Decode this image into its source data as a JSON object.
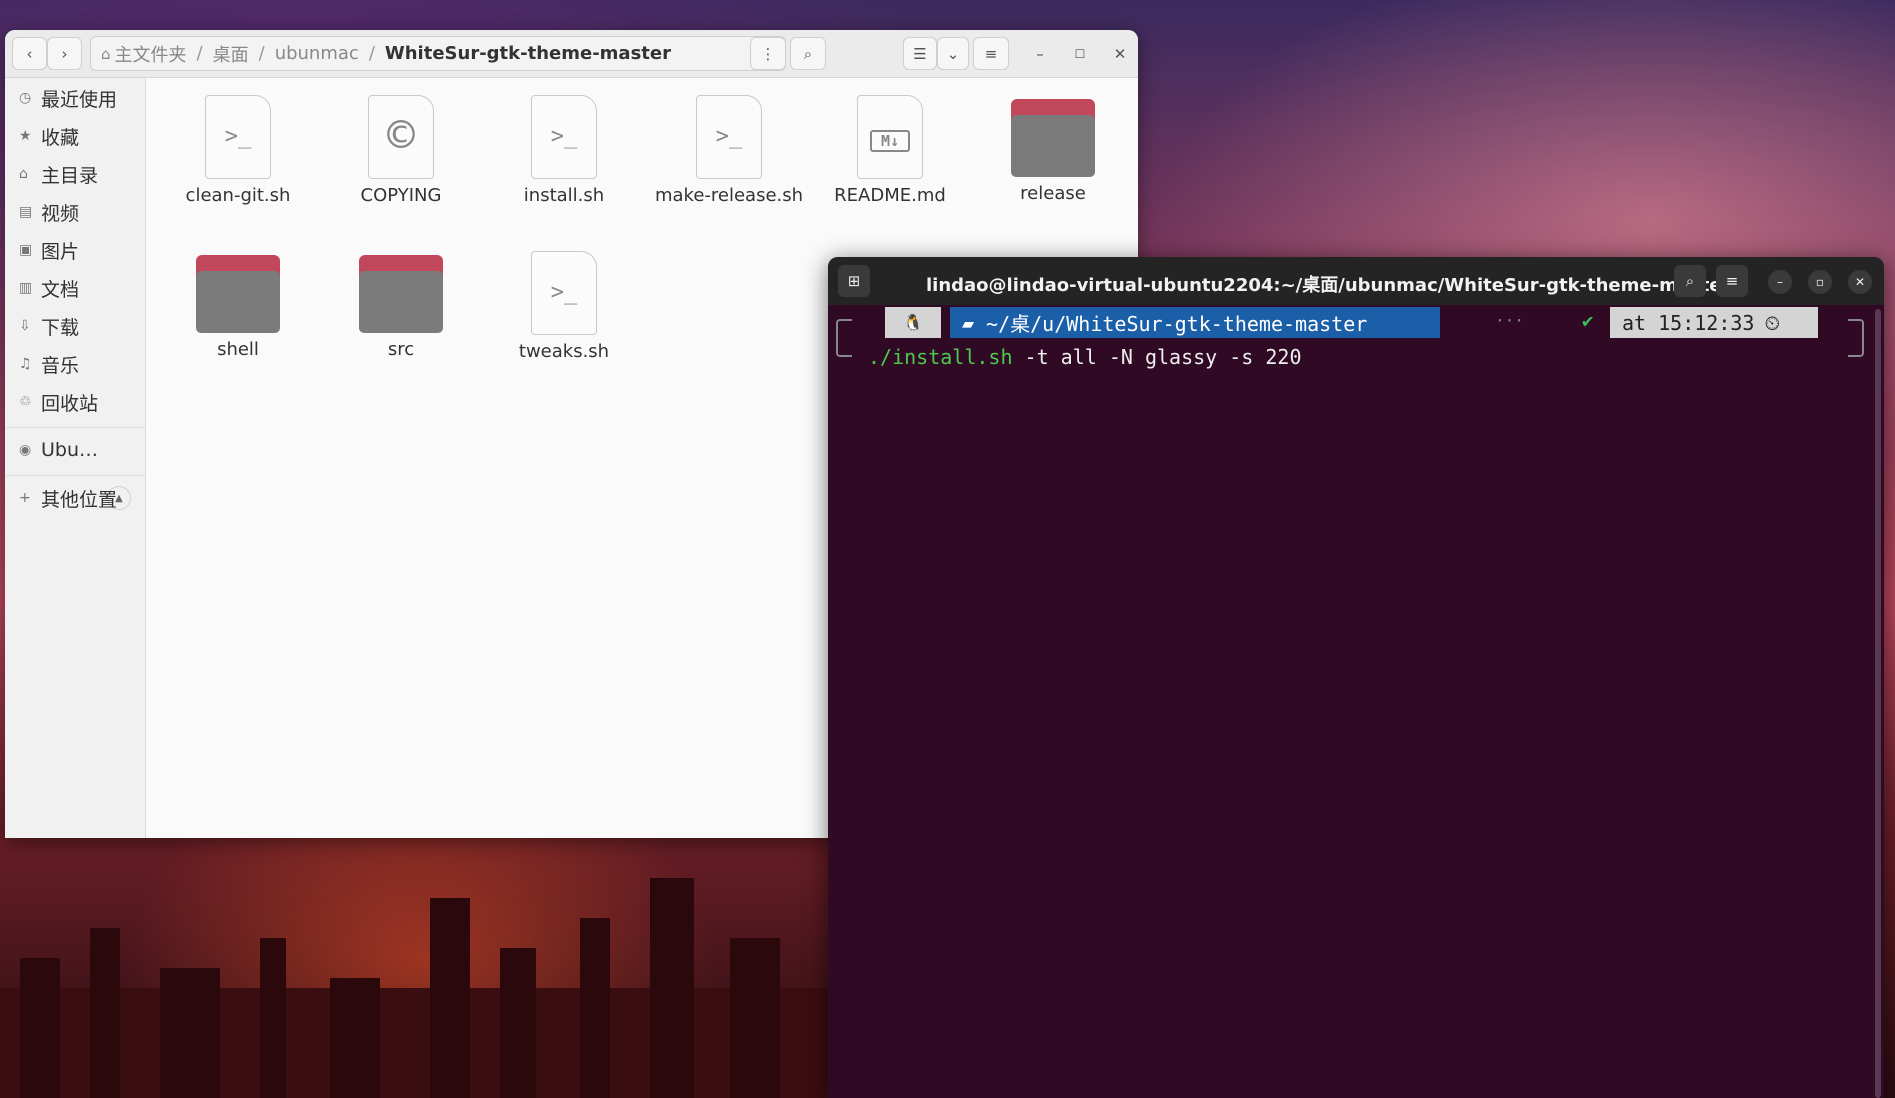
{
  "file_manager": {
    "path": [
      "主文件夹",
      "桌面",
      "ubunmac",
      "WhiteSur-gtk-theme-master"
    ],
    "sidebar": {
      "items": [
        {
          "icon": "clock-icon",
          "label": "最近使用"
        },
        {
          "icon": "star-icon",
          "label": "收藏"
        },
        {
          "icon": "home-icon",
          "label": "主目录"
        },
        {
          "icon": "video-icon",
          "label": "视频"
        },
        {
          "icon": "picture-icon",
          "label": "图片"
        },
        {
          "icon": "document-icon",
          "label": "文档"
        },
        {
          "icon": "download-icon",
          "label": "下载"
        },
        {
          "icon": "music-icon",
          "label": "音乐"
        },
        {
          "icon": "trash-icon",
          "label": "回收站"
        }
      ],
      "drive": "Ubu…",
      "other": "其他位置"
    },
    "files": [
      {
        "name": "clean-git.sh",
        "kind": "script"
      },
      {
        "name": "COPYING",
        "kind": "license"
      },
      {
        "name": "install.sh",
        "kind": "script"
      },
      {
        "name": "make-release.sh",
        "kind": "script"
      },
      {
        "name": "README.md",
        "kind": "markdown"
      },
      {
        "name": "release",
        "kind": "folder"
      },
      {
        "name": "shell",
        "kind": "folder"
      },
      {
        "name": "src",
        "kind": "folder"
      },
      {
        "name": "tweaks.sh",
        "kind": "script"
      }
    ],
    "colors": {
      "folder_tab": "#c0485a",
      "folder_body": "#7b7b7b"
    }
  },
  "terminal": {
    "title": "lindao@lindao-virtual-ubuntu2204:~/桌面/ubunmac/WhiteSur-gtk-theme-master",
    "prompt_os": "🐧",
    "prompt_dir": "~/桌/u/WhiteSur-gtk-theme-master",
    "prompt_dots": "···",
    "prompt_ok": "✔",
    "prompt_time": "at 15:12:33",
    "command_exe": "./install.sh",
    "command_args": " -t all -N glassy -s 220",
    "colors": {
      "background": "#300a24",
      "dir_segment": "#1b5fa8",
      "exe": "#4ec94e"
    }
  }
}
